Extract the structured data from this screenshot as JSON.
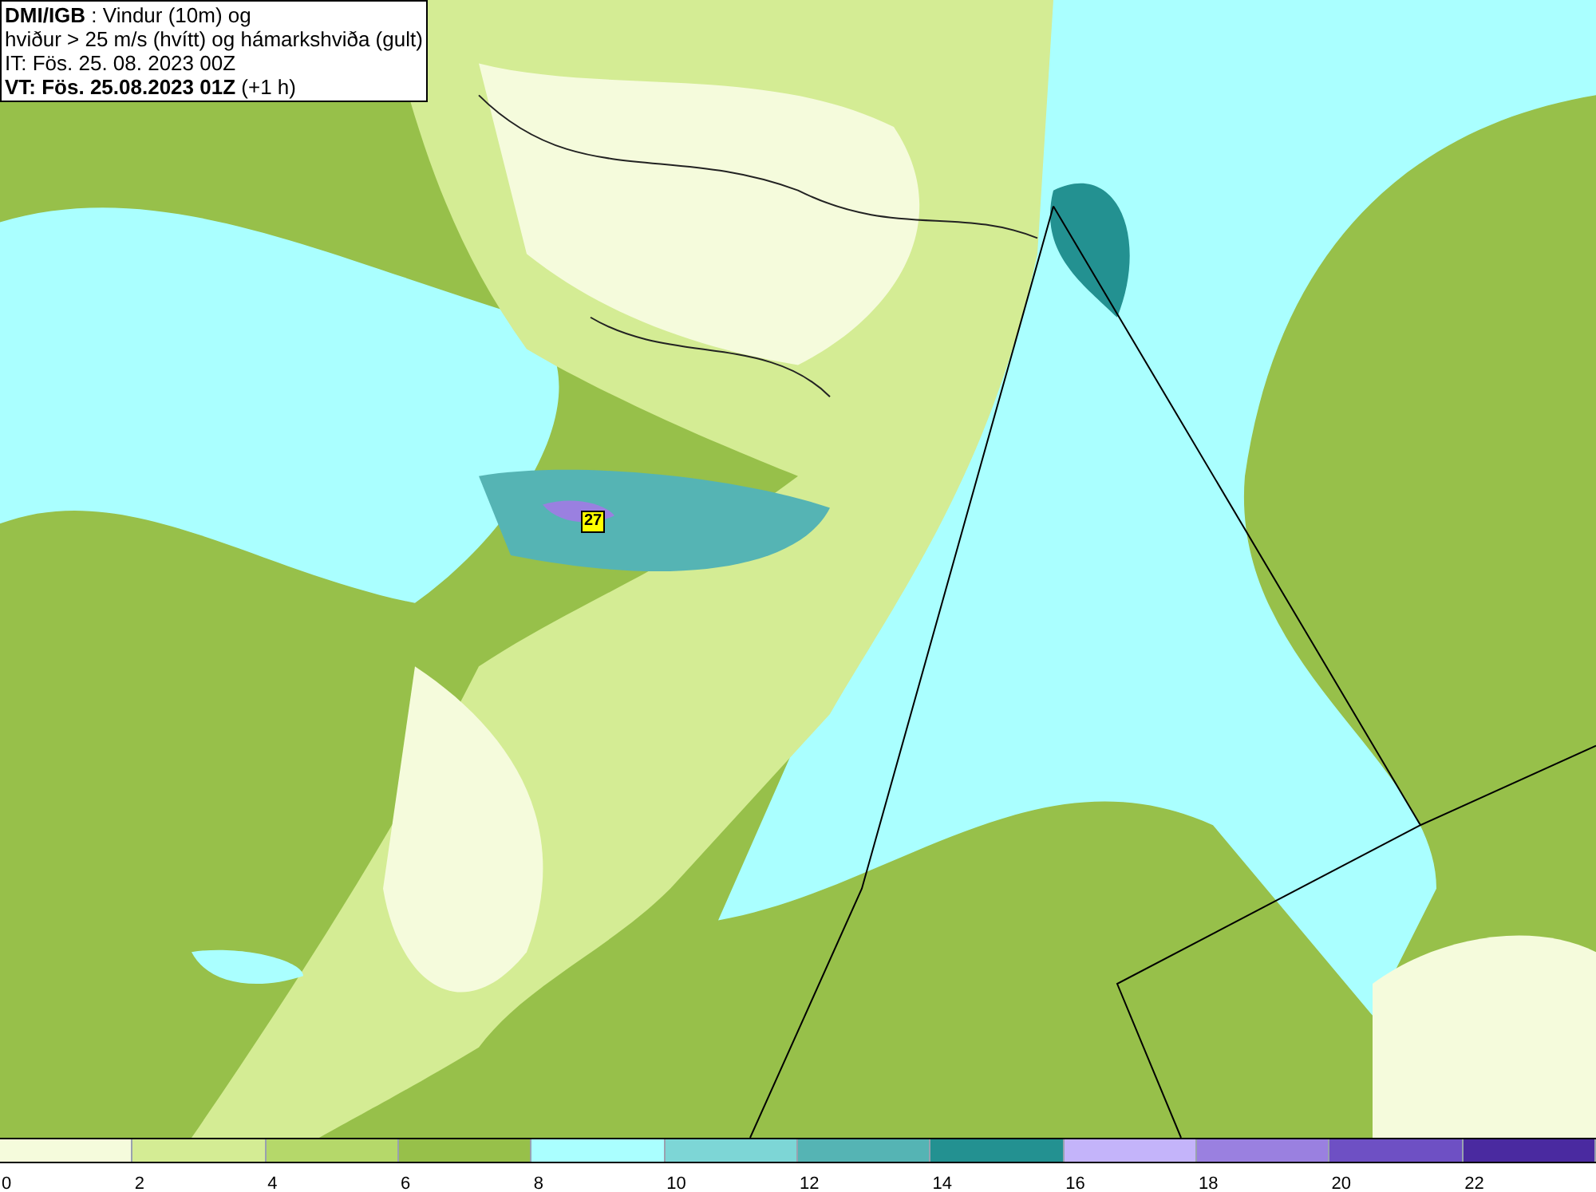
{
  "title_box": {
    "lines": [
      "**DMI/IGB** : Vindur (10m) og",
      "hviður > 25 m/s (hvítt) og hámarkshviða (gult)",
      "IT: Fös. 25. 08. 2023 00Z",
      "**VT: Fös. 25.08.2023 01Z** (+1 h)"
    ]
  },
  "map": {
    "gust_label": "27"
  },
  "legend": [
    {
      "label": "0",
      "color": "#f5fbdc"
    },
    {
      "label": "2",
      "color": "#d4ec94"
    },
    {
      "label": "4",
      "color": "#b5d86a"
    },
    {
      "label": "6",
      "color": "#97c04a"
    },
    {
      "label": "8",
      "color": "#aaffff"
    },
    {
      "label": "10",
      "color": "#7dd6d6"
    },
    {
      "label": "12",
      "color": "#55b4b4"
    },
    {
      "label": "14",
      "color": "#239191"
    },
    {
      "label": "16",
      "color": "#c4b4fa"
    },
    {
      "label": "18",
      "color": "#9a80e0"
    },
    {
      "label": "20",
      "color": "#6e50c4"
    },
    {
      "label": "22",
      "color": "#4a2aa0"
    }
  ]
}
